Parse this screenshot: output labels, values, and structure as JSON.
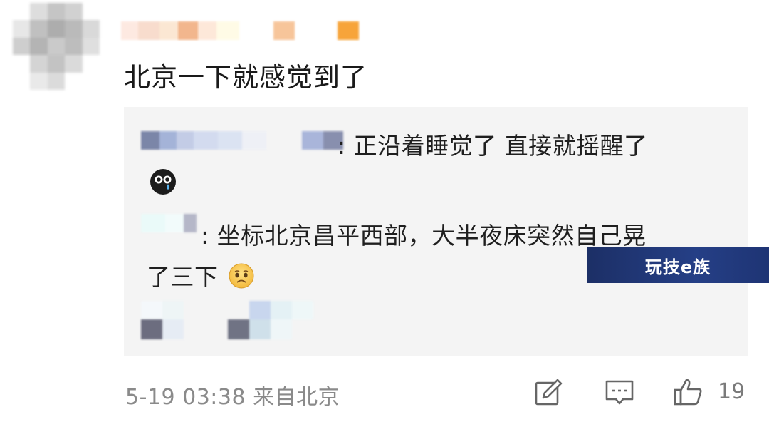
{
  "comment": {
    "text": "北京一下就感觉到了"
  },
  "replies": [
    {
      "separator": ":",
      "text": "正沿着睡觉了 直接就摇醒了",
      "emoji": "crying-emoji"
    },
    {
      "separator": ":",
      "text": "坐标北京昌平西部，大半夜床突然自己晃",
      "text_cont": "了三下",
      "emoji": "sad-face-emoji"
    }
  ],
  "watermark": {
    "text": "玩技e族"
  },
  "footer": {
    "meta": "5-19 03:38 来自北京",
    "like_count": "19",
    "icons": [
      "edit-icon",
      "comment-icon",
      "thumbs-up-icon"
    ]
  },
  "colors": {
    "reply_bg": "#f4f4f4",
    "meta_text": "#8a8a8a",
    "watermark_bg": "#1f3579"
  }
}
